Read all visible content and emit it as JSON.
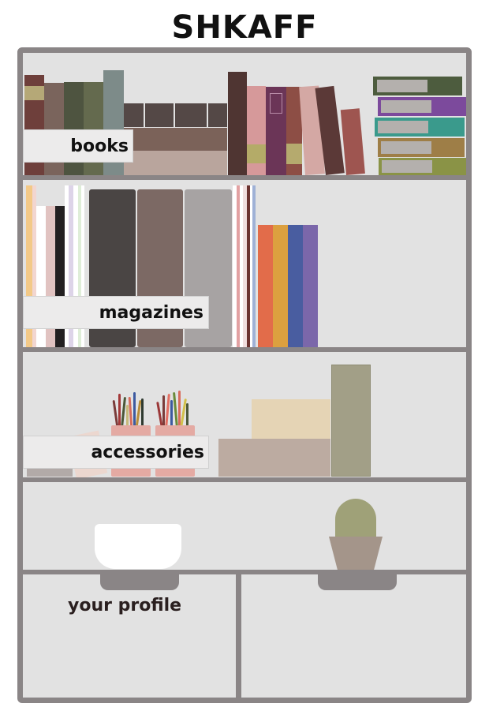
{
  "app": {
    "title": "SHKAFF"
  },
  "shelves": {
    "books": {
      "label": "books"
    },
    "magazines": {
      "label": "magazines"
    },
    "accessories": {
      "label": "accessories"
    }
  },
  "drawers": {
    "profile": {
      "label": "your profile"
    }
  },
  "colors": {
    "frame": "#8a8586",
    "background": "#e2e2e2",
    "label_bg": "#ecebeb",
    "text": "#111111"
  }
}
